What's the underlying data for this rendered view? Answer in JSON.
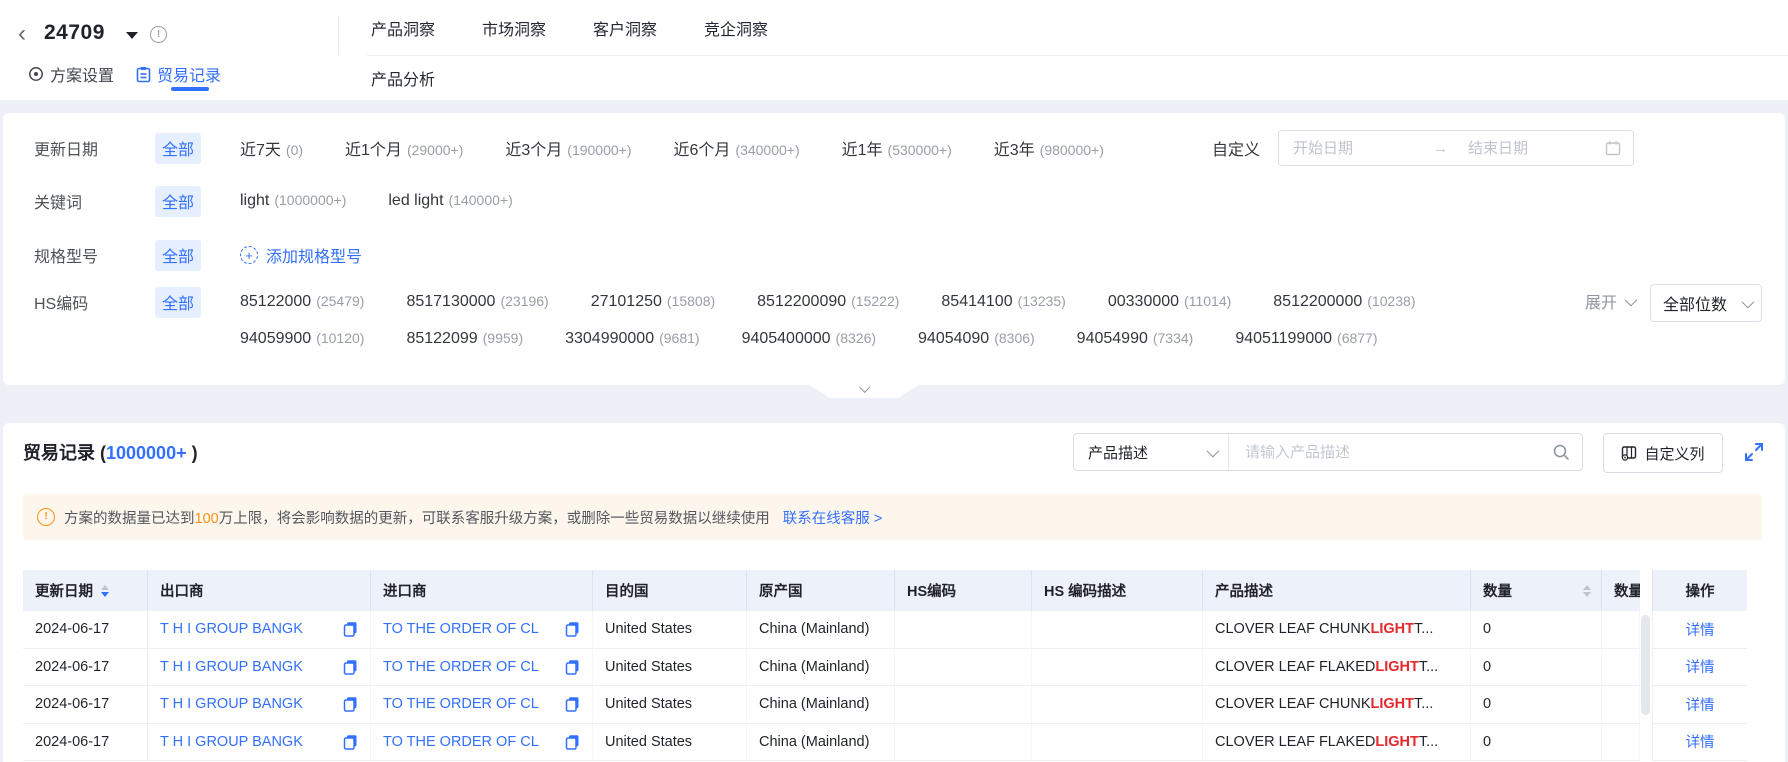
{
  "colors": {
    "accent_blue": "#3370ff",
    "warning_orange": "#ff9214",
    "keyword_red": "#e5282c",
    "banner_bg": "#fdf6ec",
    "table_header_bg": "#edf1fa",
    "page_bg": "#eef0f8",
    "chip_bg": "#e6efff"
  },
  "topbar": {
    "back_glyph": "‹",
    "plan_id": "24709",
    "info_glyph": "!",
    "nav_tabs": [
      {
        "label": "产品洞察"
      },
      {
        "label": "市场洞察"
      },
      {
        "label": "客户洞察"
      },
      {
        "label": "竞企洞察"
      }
    ],
    "view_tabs": [
      {
        "label": "方案设置"
      },
      {
        "label": "贸易记录"
      }
    ],
    "secondary_tab": "产品分析"
  },
  "filters": {
    "update_date": {
      "label": "更新日期",
      "all_label": "全部",
      "options": [
        {
          "text": "近7天",
          "count": "(0)"
        },
        {
          "text": "近1个月",
          "count": "(29000+)"
        },
        {
          "text": "近3个月",
          "count": "(190000+)"
        },
        {
          "text": "近6个月",
          "count": "(340000+)"
        },
        {
          "text": "近1年",
          "count": "(530000+)"
        },
        {
          "text": "近3年",
          "count": "(980000+)"
        }
      ],
      "custom_label": "自定义",
      "start_placeholder": "开始日期",
      "end_placeholder": "结束日期",
      "range_arrow": "→"
    },
    "keyword": {
      "label": "关键词",
      "all_label": "全部",
      "options": [
        {
          "text": "light",
          "count": "(1000000+)"
        },
        {
          "text": "led light",
          "count": "(140000+)"
        }
      ]
    },
    "spec": {
      "label": "规格型号",
      "all_label": "全部",
      "add_label": "添加规格型号",
      "plus_glyph": "+"
    },
    "hs_code": {
      "label": "HS编码",
      "all_label": "全部",
      "line1": [
        {
          "text": "85122000",
          "count": "(25479)"
        },
        {
          "text": "8517130000",
          "count": "(23196)"
        },
        {
          "text": "27101250",
          "count": "(15808)"
        },
        {
          "text": "8512200090",
          "count": "(15222)"
        },
        {
          "text": "85414100",
          "count": "(13235)"
        },
        {
          "text": "00330000",
          "count": "(11014)"
        },
        {
          "text": "8512200000",
          "count": "(10238)"
        }
      ],
      "line2": [
        {
          "text": "94059900",
          "count": "(10120)"
        },
        {
          "text": "85122099",
          "count": "(9959)"
        },
        {
          "text": "3304990000",
          "count": "(9681)"
        },
        {
          "text": "9405400000",
          "count": "(8326)"
        },
        {
          "text": "94054090",
          "count": "(8306)"
        },
        {
          "text": "94054990",
          "count": "(7334)"
        },
        {
          "text": "94051199000",
          "count": "(6877)"
        }
      ],
      "expand_label": "展开",
      "digits_label": "全部位数"
    }
  },
  "records": {
    "title": "贸易记录",
    "count": "1000000+",
    "paren_open": "(",
    "paren_close": ")",
    "search_field_label": "产品描述",
    "search_placeholder": "请输入产品描述",
    "customize_columns_label": "自定义列",
    "warning": {
      "icon_glyph": "!",
      "pre": "方案的数据量已达到",
      "highlight": "100",
      "post": "万上限，将会影响数据的更新，可联系客服升级方案，或删除一些贸易数据以继续使用",
      "link": "联系在线客服 >"
    },
    "table": {
      "headers": [
        "更新日期",
        "出口商",
        "进口商",
        "目的国",
        "原产国",
        "HS编码",
        "HS 编码描述",
        "产品描述",
        "数量",
        "数量",
        "操作"
      ],
      "rows": [
        {
          "date": "2024-06-17",
          "exporter": "T H I GROUP BANGK",
          "importer": "TO THE ORDER OF CL",
          "destination": "United States",
          "origin": "China (Mainland)",
          "hs_code": "",
          "hs_desc": "",
          "desc_pre": "CLOVER LEAF CHUNK ",
          "desc_kw": "LIGHT",
          "desc_post": " T...",
          "qty": "0",
          "action": "详情"
        },
        {
          "date": "2024-06-17",
          "exporter": "T H I GROUP BANGK",
          "importer": "TO THE ORDER OF CL",
          "destination": "United States",
          "origin": "China (Mainland)",
          "hs_code": "",
          "hs_desc": "",
          "desc_pre": "CLOVER LEAF FLAKED ",
          "desc_kw": "LIGHT",
          "desc_post": " T...",
          "qty": "0",
          "action": "详情"
        },
        {
          "date": "2024-06-17",
          "exporter": "T H I GROUP BANGK",
          "importer": "TO THE ORDER OF CL",
          "destination": "United States",
          "origin": "China (Mainland)",
          "hs_code": "",
          "hs_desc": "",
          "desc_pre": "CLOVER LEAF CHUNK ",
          "desc_kw": "LIGHT",
          "desc_post": " T...",
          "qty": "0",
          "action": "详情"
        },
        {
          "date": "2024-06-17",
          "exporter": "T H I GROUP BANGK",
          "importer": "TO THE ORDER OF CL",
          "destination": "United States",
          "origin": "China (Mainland)",
          "hs_code": "",
          "hs_desc": "",
          "desc_pre": "CLOVER LEAF FLAKED ",
          "desc_kw": "LIGHT",
          "desc_post": " T...",
          "qty": "0",
          "action": "详情"
        }
      ]
    }
  }
}
